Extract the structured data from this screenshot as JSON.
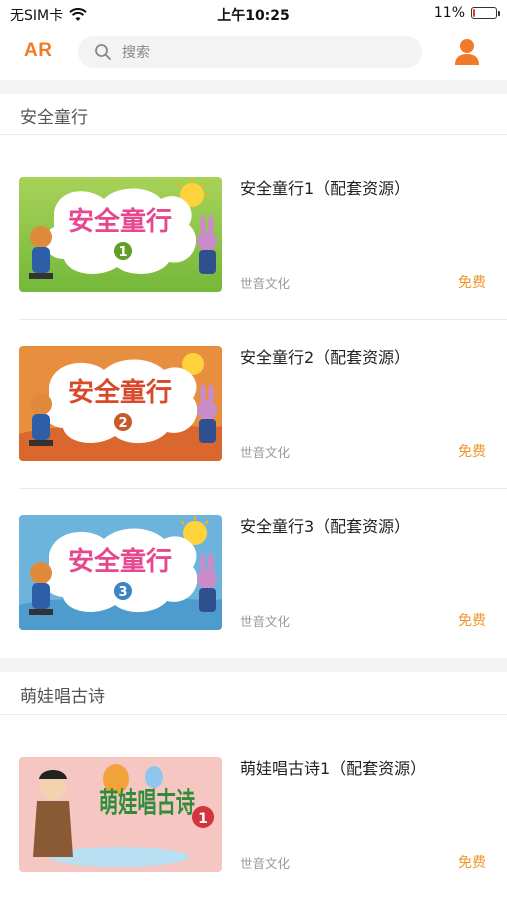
{
  "status_bar": {
    "carrier": "无SIM卡",
    "time": "上午10:25",
    "battery": "11%",
    "battery_level": 0.11
  },
  "nav": {
    "ar_label": "AR",
    "search_placeholder": "搜索"
  },
  "sections": [
    {
      "title": "安全童行",
      "items": [
        {
          "title": "安全童行1（配套资源）",
          "publisher": "世音文化",
          "price": "免费",
          "cover_text": "安全童行",
          "cover_number": "1"
        },
        {
          "title": "安全童行2（配套资源）",
          "publisher": "世音文化",
          "price": "免费",
          "cover_text": "安全童行",
          "cover_number": "2"
        },
        {
          "title": "安全童行3（配套资源）",
          "publisher": "世音文化",
          "price": "免费",
          "cover_text": "安全童行",
          "cover_number": "3"
        }
      ]
    },
    {
      "title": "萌娃唱古诗",
      "items": [
        {
          "title": "萌娃唱古诗1（配套资源）",
          "publisher": "世音文化",
          "price": "免费",
          "cover_text": "萌娃唱古诗",
          "cover_number": "1"
        }
      ]
    }
  ],
  "colors": {
    "accent": "#f07b27",
    "price": "#f0962b"
  }
}
